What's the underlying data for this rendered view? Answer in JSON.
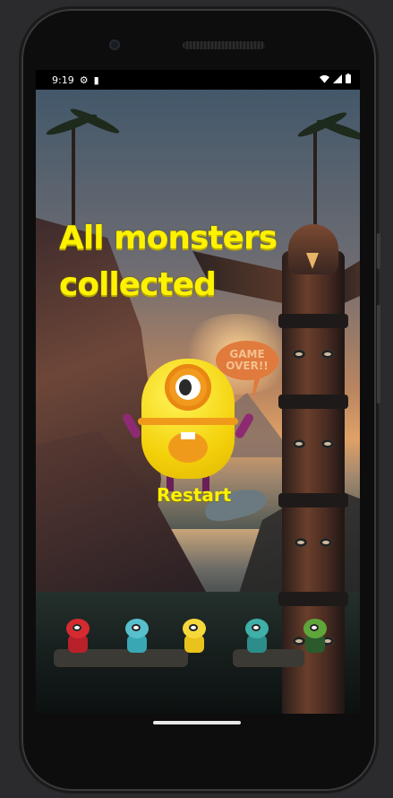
{
  "status_bar": {
    "time": "9:19",
    "icons": [
      "settings-icon",
      "sim-card-icon",
      "wifi-icon",
      "signal-icon",
      "battery-icon"
    ]
  },
  "game": {
    "title": "All monsters collected",
    "speech_bubble": "GAME OVER!!",
    "restart_label": "Restart",
    "collected_monsters": [
      "red-horned-monster",
      "teal-furry-monster",
      "yellow-horned-monster",
      "teal-alien-monster",
      "green-zombie-monster"
    ]
  },
  "colors": {
    "title": "#fff200",
    "bubble": "#e07a3d",
    "monster_body": "#f4d20c"
  }
}
